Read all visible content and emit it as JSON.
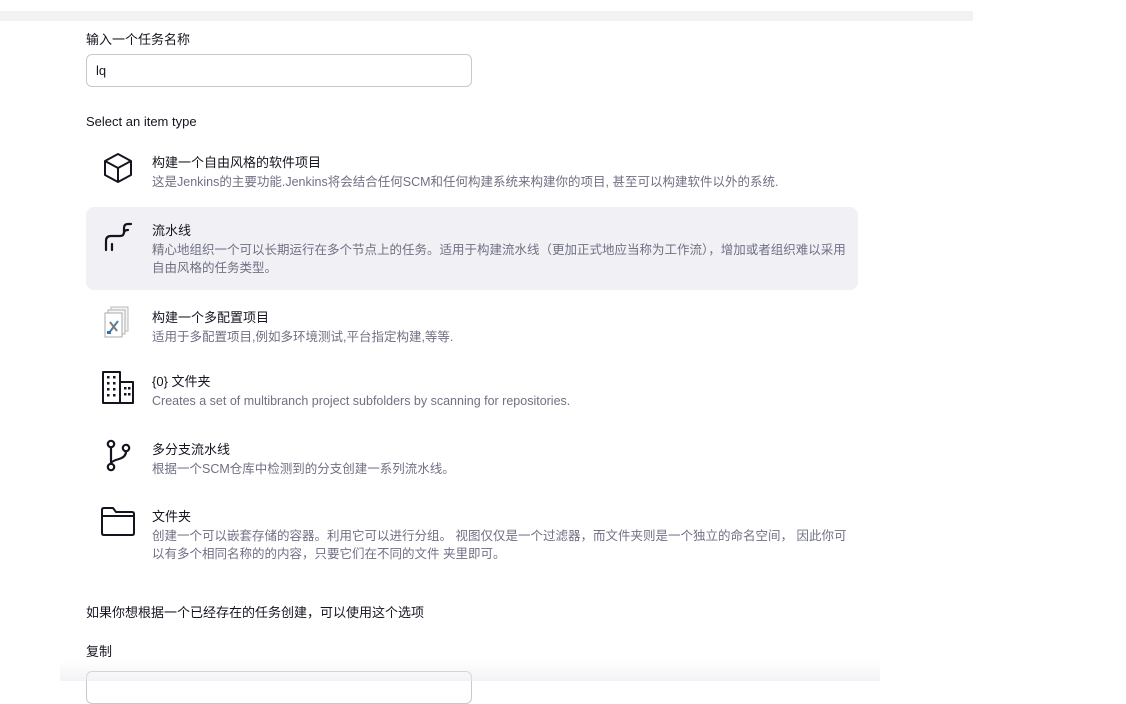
{
  "form": {
    "name_label": "输入一个任务名称",
    "name_value": "lq",
    "section_label": "Select an item type",
    "copy_hint": "如果你想根据一个已经存在的任务创建，可以使用这个选项",
    "copy_label": "复制",
    "copy_value": ""
  },
  "items": [
    {
      "title": "构建一个自由风格的软件项目",
      "desc": "这是Jenkins的主要功能.Jenkins将会结合任何SCM和任何构建系统来构建你的项目, 甚至可以构建软件以外的系统.",
      "icon": "freestyle-cube-icon",
      "selected": false
    },
    {
      "title": "流水线",
      "desc": "精心地组织一个可以长期运行在多个节点上的任务。适用于构建流水线（更加正式地应当称为工作流），增加或者组织难以采用自由风格的任务类型。",
      "icon": "pipeline-icon",
      "selected": true
    },
    {
      "title": "构建一个多配置项目",
      "desc": "适用于多配置项目,例如多环境测试,平台指定构建,等等.",
      "icon": "multi-config-icon",
      "selected": false
    },
    {
      "title": "{0} 文件夹",
      "desc": "Creates a set of multibranch project subfolders by scanning for repositories.",
      "icon": "organization-folder-icon",
      "selected": false
    },
    {
      "title": "多分支流水线",
      "desc": "根据一个SCM仓库中检测到的分支创建一系列流水线。",
      "icon": "branch-icon",
      "selected": false
    },
    {
      "title": "文件夹",
      "desc": "创建一个可以嵌套存储的容器。利用它可以进行分组。 视图仅仅是一个过滤器，而文件夹则是一个独立的命名空间， 因此你可以有多个相同名称的的内容，只要它们在不同的文件 夹里即可。",
      "icon": "folder-icon",
      "selected": false
    }
  ],
  "colors": {
    "selected_bg": "#f1f1f5",
    "text": "#14141f",
    "muted": "#707084"
  }
}
